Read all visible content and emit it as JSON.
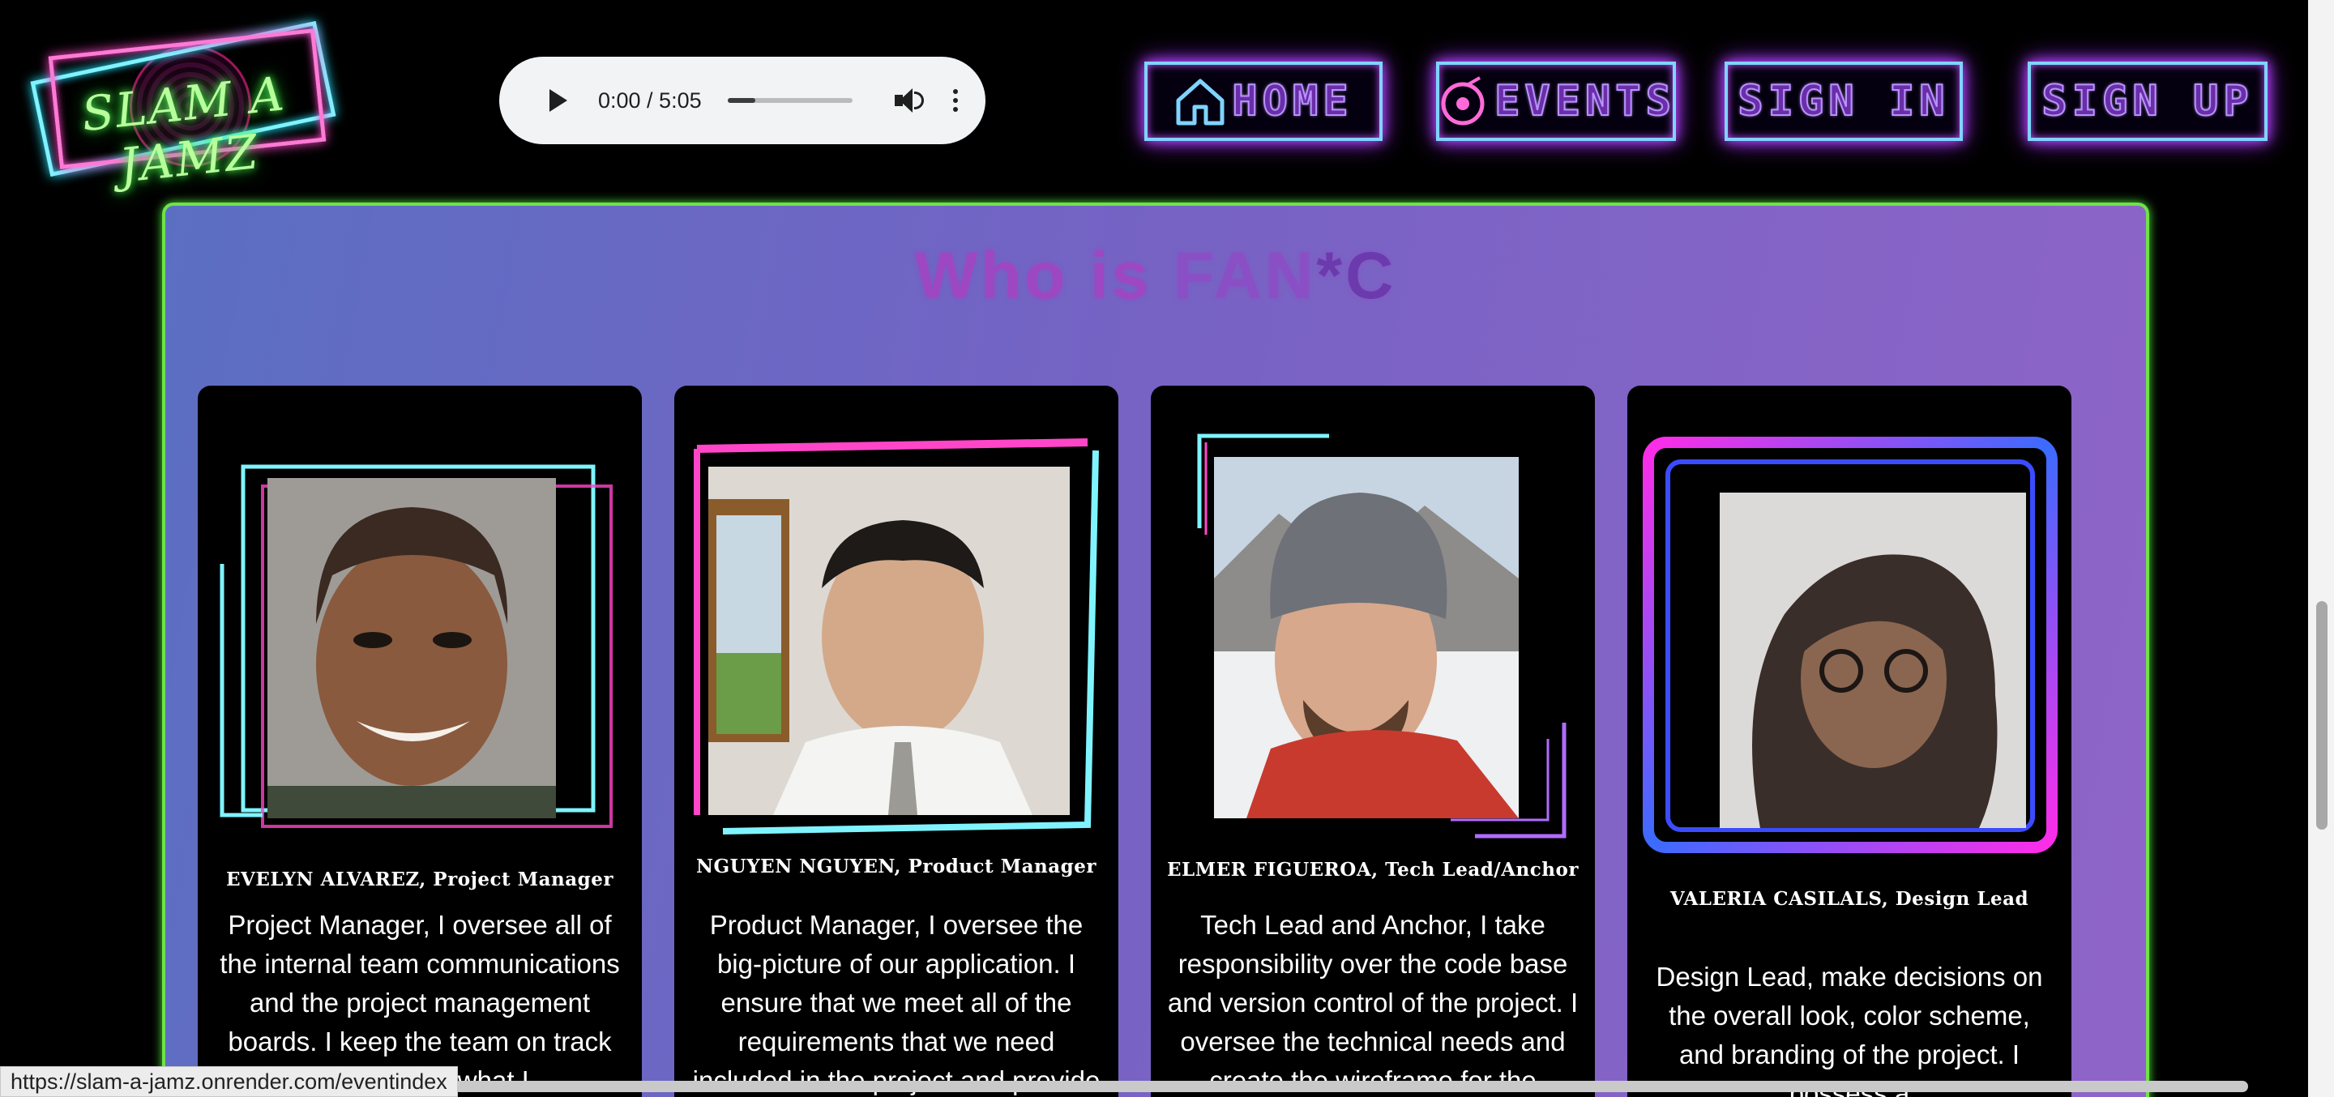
{
  "logo": {
    "text": "SLAM A JAMZ"
  },
  "audio": {
    "time": "0:00 / 5:05",
    "progress": 0.0
  },
  "nav": {
    "home": "HOME",
    "events": "EVENTS",
    "sign_in": "SIGN IN",
    "sign_up": "SIGN UP"
  },
  "section": {
    "title_a": "Who is ",
    "title_b": "FAN",
    "title_c": "*C"
  },
  "team": [
    {
      "name": "EVELYN ALVAREZ, Project Manager",
      "bio": "Project Manager, I oversee all of the internal team communications and the project management boards. I keep the team on track ensuring on what I"
    },
    {
      "name": "NGUYEN NGUYEN, Product Manager",
      "bio": "Product Manager, I oversee the big-picture of our application. I ensure that we meet all of the requirements that we need included in the project and provide"
    },
    {
      "name": "ELMER FIGUEROA, Tech Lead/Anchor",
      "bio": "Tech Lead and Anchor, I take responsibility over the code base and version control of the project. I oversee the technical needs and create the wireframe for the"
    },
    {
      "name": "VALERIA CASILALS, Design Lead",
      "bio": "Design Lead, make decisions on the overall look, color scheme, and branding of the project. I possess a"
    }
  ],
  "status_url": "https://slam-a-jamz.onrender.com/eventindex",
  "colors": {
    "neon_green": "#6fe24a",
    "neon_pink": "#ff46c8",
    "neon_cyan": "#28e6ff",
    "nav_text": "#6a2ea8",
    "panel_start": "#5b6fc2",
    "panel_end": "#8f64c8"
  }
}
